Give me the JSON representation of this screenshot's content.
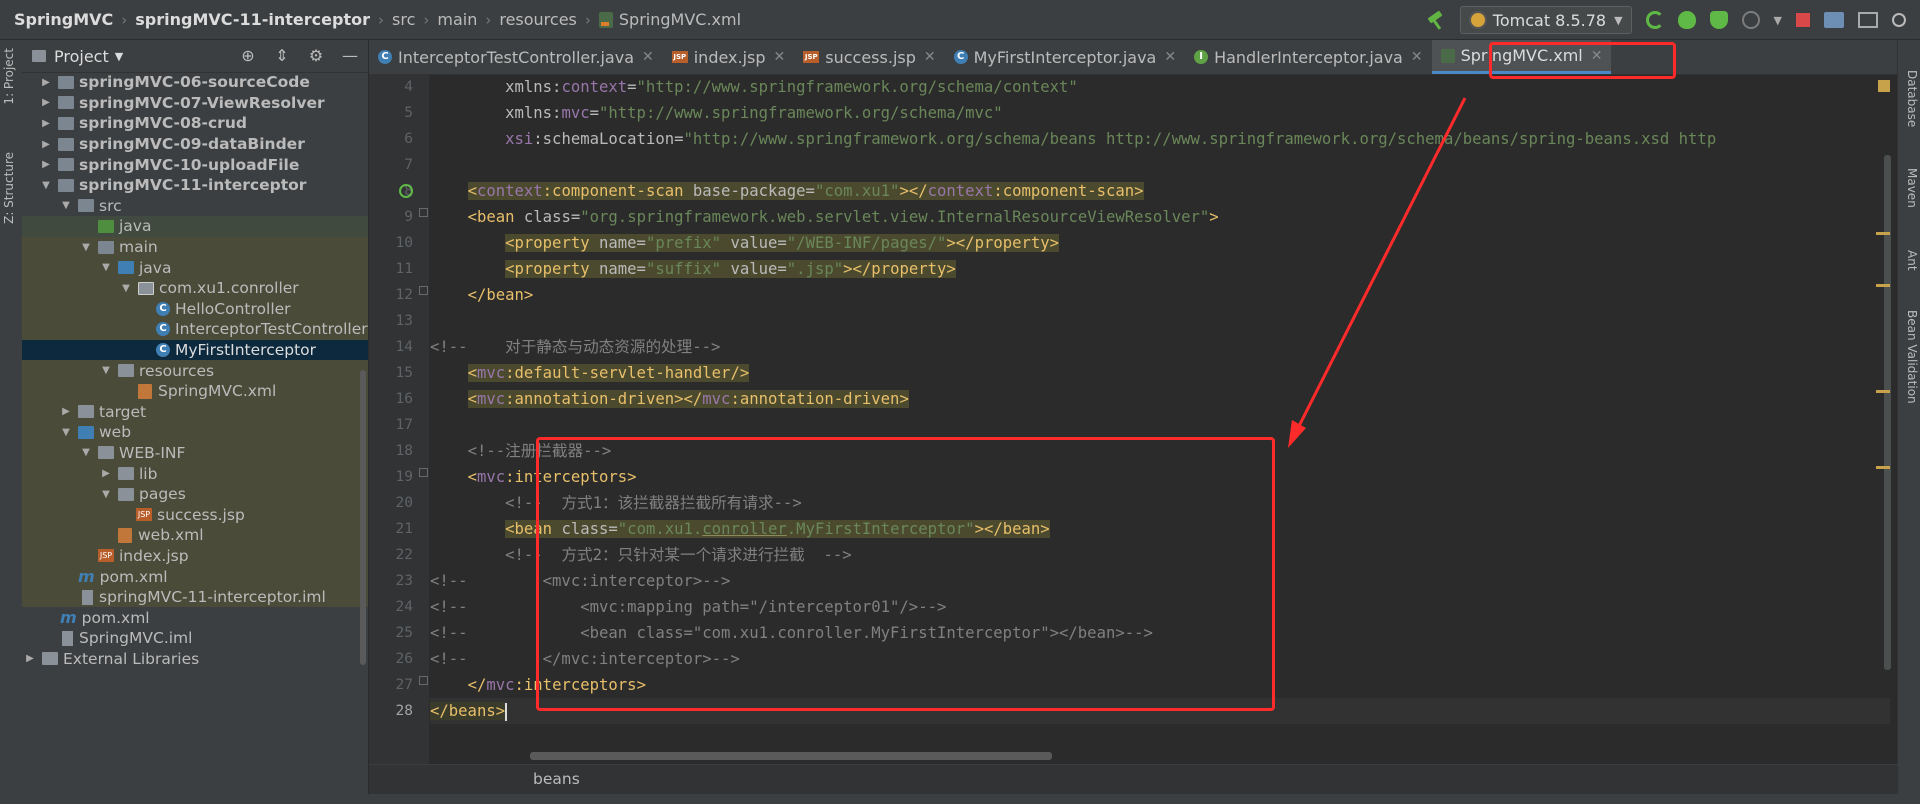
{
  "breadcrumbs": [
    "SpringMVC",
    "springMVC-11-interceptor",
    "src",
    "main",
    "resources",
    "SpringMVC.xml"
  ],
  "run_config": "Tomcat 8.5.78",
  "left_tool_tabs": {
    "project": "1: Project",
    "structure": "Z: Structure"
  },
  "right_tool_tabs": [
    "Database",
    "Maven",
    "Ant",
    "Bean Validation"
  ],
  "project_panel": {
    "title": "Project",
    "tree": [
      {
        "label": "springMVC-06-sourceCode",
        "bold": true
      },
      {
        "label": "springMVC-07-ViewResolver",
        "bold": true
      },
      {
        "label": "springMVC-08-crud",
        "bold": true
      },
      {
        "label": "springMVC-09-dataBinder",
        "bold": true
      },
      {
        "label": "springMVC-10-uploadFile",
        "bold": true
      },
      {
        "label": "springMVC-11-interceptor",
        "bold": true
      },
      {
        "label": "src"
      },
      {
        "label": "java"
      },
      {
        "label": "main"
      },
      {
        "label": "java"
      },
      {
        "label": "com.xu1.conroller"
      },
      {
        "label": "HelloController"
      },
      {
        "label": "InterceptorTestController"
      },
      {
        "label": "MyFirstInterceptor"
      },
      {
        "label": "resources"
      },
      {
        "label": "SpringMVC.xml"
      },
      {
        "label": "target"
      },
      {
        "label": "web"
      },
      {
        "label": "WEB-INF"
      },
      {
        "label": "lib"
      },
      {
        "label": "pages"
      },
      {
        "label": "success.jsp"
      },
      {
        "label": "web.xml"
      },
      {
        "label": "index.jsp"
      },
      {
        "label": "pom.xml"
      },
      {
        "label": "springMVC-11-interceptor.iml"
      },
      {
        "label": "pom.xml"
      },
      {
        "label": "SpringMVC.iml"
      },
      {
        "label": "External Libraries"
      }
    ]
  },
  "editor_tabs": [
    {
      "label": "InterceptorTestController.java",
      "type": "class"
    },
    {
      "label": "index.jsp",
      "type": "jsp"
    },
    {
      "label": "success.jsp",
      "type": "jsp"
    },
    {
      "label": "MyFirstInterceptor.java",
      "type": "class"
    },
    {
      "label": "HandlerInterceptor.java",
      "type": "interface"
    },
    {
      "label": "SpringMVC.xml",
      "type": "xml",
      "active": true
    }
  ],
  "line_numbers": [
    "4",
    "5",
    "6",
    "7",
    "8",
    "9",
    "10",
    "11",
    "12",
    "13",
    "14",
    "15",
    "16",
    "17",
    "18",
    "19",
    "20",
    "21",
    "22",
    "23",
    "24",
    "25",
    "26",
    "27",
    "28"
  ],
  "code": {
    "l4a": "        xmlns:",
    "l4ns": "context",
    "l4b": "=",
    "l4v": "\"http://www.springframework.org/schema/context\"",
    "l5a": "        xmlns:",
    "l5ns": "mvc",
    "l5b": "=",
    "l5v": "\"http://www.springframework.org/schema/mvc\"",
    "l6ns": "xsi",
    "l6a": ":schemaLocation=",
    "l6v": "\"http://www.springframework.org/schema/beans http://www.springframework.org/schema/beans/spring-beans.xsd http",
    "l8t1": "<",
    "l8ns": "context",
    "l8t2": ":component-scan ",
    "l8a": "base-package=",
    "l8v": "\"com.xu1\"",
    "l8t3": "></",
    "l8ns2": "context",
    "l8t4": ":component-scan>",
    "l9t": "<bean ",
    "l9a": "class=",
    "l9v": "\"org.springframework.web.servlet.view.InternalResourceViewResolver\"",
    "l9t2": ">",
    "l10t": "<property ",
    "l10a": "name=",
    "l10v": "\"prefix\" ",
    "l10a2": "value=",
    "l10v2": "\"/WEB-INF/pages/\"",
    "l10t2": "></property>",
    "l11t": "<property ",
    "l11a": "name=",
    "l11v": "\"suffix\" ",
    "l11a2": "value=",
    "l11v2": "\".jsp\"",
    "l11t2": "></property>",
    "l12t": "</bean>",
    "l14c": "<!--    对于静态与动态资源的处理-->",
    "l15t": "<",
    "l15ns": "mvc",
    "l15t2": ":default-servlet-handler/>",
    "l16t": "<",
    "l16ns": "mvc",
    "l16t2": ":annotation-driven></",
    "l16ns2": "mvc",
    "l16t3": ":annotation-driven>",
    "l18c": "<!--注册拦截器-->",
    "l19t": "<",
    "l19ns": "mvc",
    "l19t2": ":interceptors>",
    "l20c": "<!--  方式1：该拦截器拦截所有请求-->",
    "l21t": "<bean ",
    "l21a": "class=",
    "l21v1": "\"com.xu1.",
    "l21v2": "conroller",
    "l21v3": ".MyFirstInterceptor\"",
    "l21t2": "></bean>",
    "l22c": "<!--  方式2：只针对某一个请求进行拦截  -->",
    "l23c": "<!--        <mvc:interceptor>-->",
    "l24c": "<!--            <mvc:mapping path=\"/interceptor01\"/>-->",
    "l25c": "<!--            <bean class=\"com.xu1.conroller.MyFirstInterceptor\"></bean>-->",
    "l26c": "<!--        </mvc:interceptor>-->",
    "l27t": "</",
    "l27ns": "mvc",
    "l27t2": ":interceptors>",
    "l28t": "</beans>"
  },
  "status_breadcrumb": "beans",
  "colors": {
    "annotation_red": "#ff2b2b",
    "tag": "#e8bf6a",
    "namespace": "#9876aa",
    "string": "#6a8759",
    "comment": "#808080"
  }
}
